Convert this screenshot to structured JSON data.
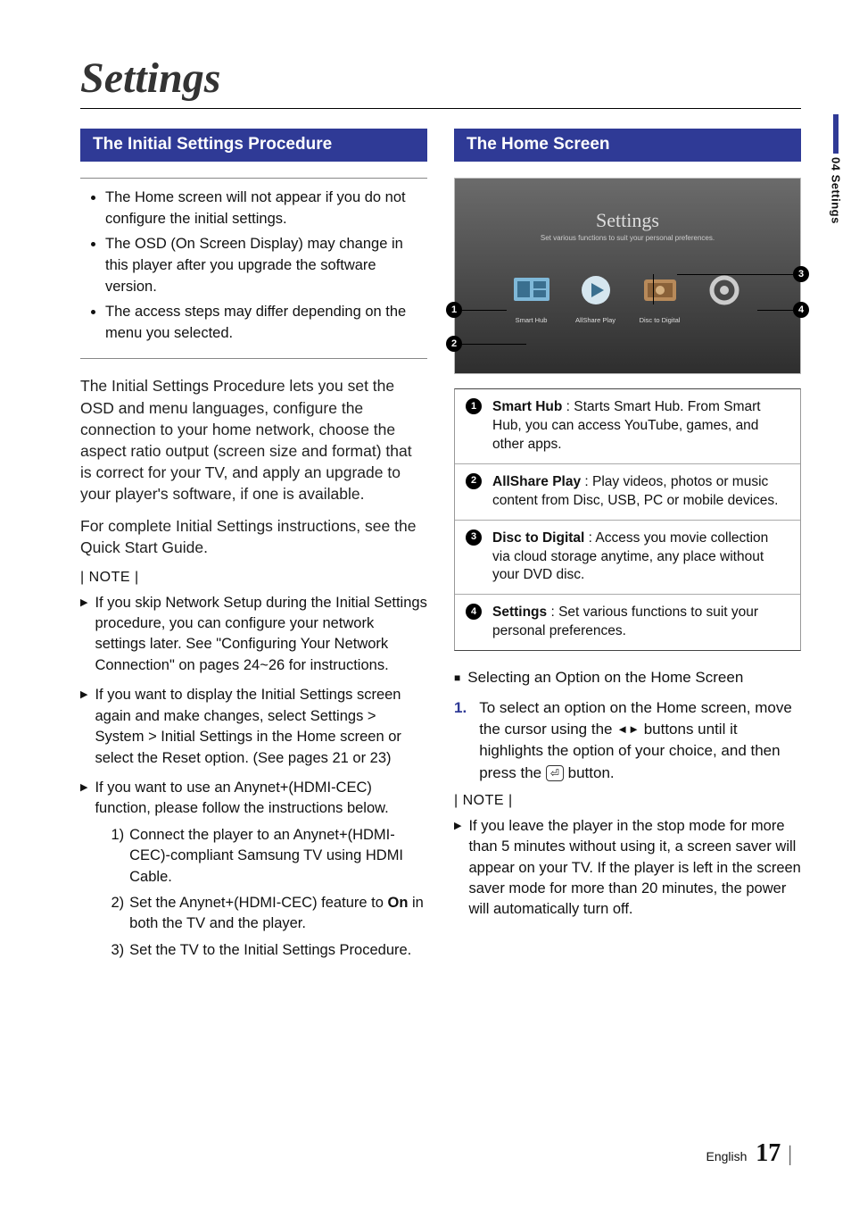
{
  "page": {
    "title": "Settings",
    "side_tab": "04  Settings",
    "footer_lang": "English",
    "footer_page": "17"
  },
  "left": {
    "header": "The Initial Settings Procedure",
    "box_bullets": [
      "The Home screen will not appear if you do not configure the initial settings.",
      "The OSD (On Screen Display) may change in this player after you upgrade the software version.",
      "The access steps may differ depending on the menu you selected."
    ],
    "para1": "The Initial Settings Procedure lets you set the OSD and menu languages, configure the connection to your home network, choose the aspect ratio output (screen size and format) that is correct for your TV, and apply an upgrade to your player's software, if one is available.",
    "para2": "For complete Initial Settings instructions, see the Quick Start Guide.",
    "note_label": "| NOTE |",
    "notes": [
      "If you skip Network Setup during the Initial Settings procedure, you can configure your network settings later. See \"Configuring Your Network Connection\" on pages 24~26 for instructions.",
      "If you want to display the Initial Settings screen again and make changes, select Settings > System > Initial Settings in the Home screen or select the Reset option. (See pages 21 or 23)",
      "If you want to use an Anynet+(HDMI-CEC) function, please follow the instructions below."
    ],
    "sub_steps": [
      {
        "n": "1)",
        "t": "Connect the player to an Anynet+(HDMI-CEC)-compliant Samsung TV using HDMI Cable."
      },
      {
        "n": "2)",
        "t_pre": "Set the Anynet+(HDMI-CEC) feature to ",
        "t_bold": "On",
        "t_post": " in both the TV and the player."
      },
      {
        "n": "3)",
        "t": "Set the TV to the Initial Settings Procedure."
      }
    ]
  },
  "right": {
    "header": "The Home Screen",
    "figure": {
      "title": "Settings",
      "subtitle": "Set various functions to suit your personal preferences.",
      "tiles": [
        "Smart Hub",
        "AllShare Play",
        "Disc to Digital",
        ""
      ]
    },
    "legend": [
      {
        "badge": "1",
        "bold": "Smart Hub",
        "text": " : Starts Smart Hub. From Smart Hub, you can access YouTube, games, and other apps."
      },
      {
        "badge": "2",
        "bold": "AllShare Play",
        "text": " : Play videos, photos or music content from Disc, USB, PC or mobile devices."
      },
      {
        "badge": "3",
        "bold": "Disc to Digital",
        "text": " : Access you movie collection via cloud storage anytime, any place without your DVD disc."
      },
      {
        "badge": "4",
        "bold": "Settings",
        "text": " : Set various functions to suit your personal preferences."
      }
    ],
    "subhead": "Selecting an Option on the Home Screen",
    "step1_pre": "To select an option on the Home screen, move the cursor using the ",
    "step1_mid": " buttons until it highlights the option of your choice, and then press the ",
    "step1_post": " button.",
    "note_label": "| NOTE |",
    "note1": "If you leave the player in the stop mode for more than 5 minutes without using it, a screen saver will appear on your TV. If the player is left in the screen saver mode for more than 20 minutes, the power will automatically turn off."
  }
}
